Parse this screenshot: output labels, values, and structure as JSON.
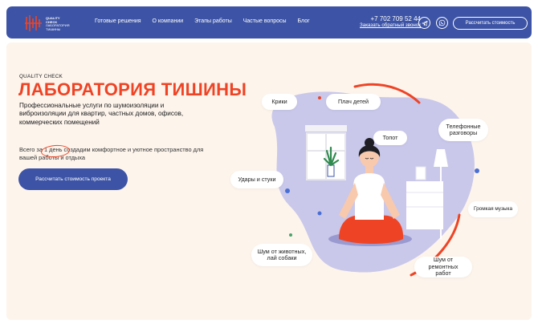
{
  "header": {
    "logo": {
      "line1": "QUALITY",
      "line2": "CHECK",
      "line3": "ЛАБОРАТОРИЯ",
      "line4": "ТИШИНЫ"
    },
    "nav": [
      "Готовые решения",
      "О компании",
      "Этапы работы",
      "Частые вопросы",
      "Блог"
    ],
    "phone": "+7 702 709 52 44",
    "callback": "Заказать обратный звонок",
    "cta": "Рассчитать стоимость"
  },
  "hero": {
    "eyebrow": "QUALITY CHECK",
    "title": "ЛАБОРАТОРИЯ ТИШИНЫ",
    "description": "Профессиональные услуги по шумоизоляции и виброизоляции для квартир, частных домов, офисов, коммерческих помещений",
    "note": "Всего за 1 день создадим комфортное и уютное пространство для вашей работы и отдыха",
    "cta": "Рассчитать стоимость проекта"
  },
  "clouds": {
    "shouts": "Крики",
    "baby": "Плач детей",
    "phone_calls": "Телефонные разговоры",
    "stomping": "Топот",
    "hits": "Удары и стуки",
    "loud_music": "Громкая музыка",
    "animals": "Шум от животных, лай собаки",
    "repair": "Шум от ремонтных работ"
  },
  "colors": {
    "primary": "#3d54a6",
    "accent": "#ee4425",
    "hero_bg": "#fdf4ec",
    "blob": "#c9c8ea"
  }
}
